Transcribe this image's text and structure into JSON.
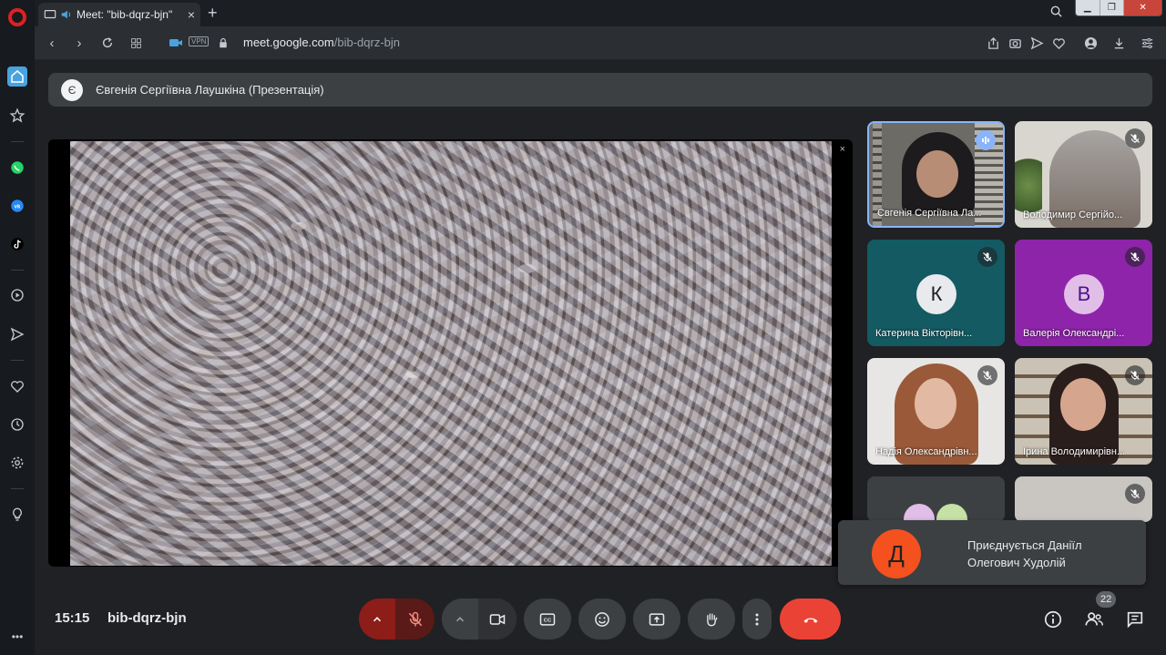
{
  "browser": {
    "tab_title": "Meet: \"bib-dqrz-bjn\"",
    "tab_close": "×",
    "new_tab": "+",
    "url_host": "meet.google.com",
    "url_path": "/bib-dqrz-bjn",
    "vpn_label": "VPN",
    "sidebar_icons": [
      "opera-logo",
      "home-icon",
      "star-icon",
      "whatsapp-icon",
      "vk-icon",
      "tiktok-icon",
      "player-icon",
      "send-icon",
      "heart-icon",
      "history-icon",
      "settings-icon",
      "bulb-icon"
    ]
  },
  "meet": {
    "presenter_initial": "Є",
    "presenter_label": "Євгенія Сергіївна Лаушкіна (Презентація)",
    "presentation_close": "×",
    "participants": [
      {
        "name": "Євгенія Сергіївна Ла...",
        "speaking": true
      },
      {
        "name": "Володимир Сергійо...",
        "muted": true
      },
      {
        "name": "Катерина Вікторівн...",
        "initial": "К",
        "muted": true,
        "avatar_color": "#e8eaed",
        "tile_color": "#135a63"
      },
      {
        "name": "Валерія Олександрі...",
        "initial": "В",
        "muted": true,
        "avatar_color": "#e1bee7",
        "tile_color": "#8e24aa"
      },
      {
        "name": "Надія Олександрівн...",
        "muted": true
      },
      {
        "name": "Ірина Володимирівн...",
        "muted": true
      }
    ],
    "toast_initial": "Д",
    "toast_text": "Приєднується Даніїл Олегович Худолій",
    "time": "15:15",
    "meeting_code": "bib-dqrz-bjn",
    "participant_count": "22",
    "colors": {
      "end_call": "#ea4335",
      "mic_off": "#d93025",
      "active_speaker": "#8ab4f8"
    }
  }
}
